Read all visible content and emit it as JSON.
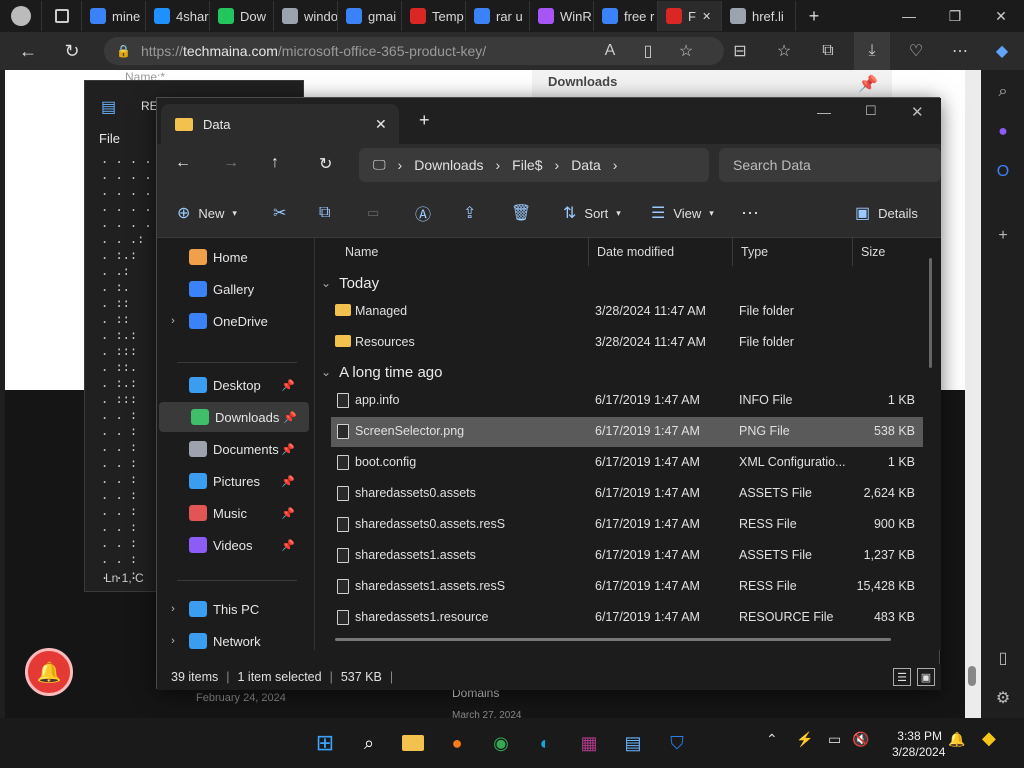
{
  "browser": {
    "tabs": [
      {
        "label": "mine",
        "icon": "search-icon",
        "color": "#3b82f6"
      },
      {
        "label": "4shar",
        "icon": "4shared-icon",
        "color": "#1e90ff"
      },
      {
        "label": "Dow",
        "icon": "download-site-icon",
        "color": "#22c55e"
      },
      {
        "label": "windo",
        "icon": "puzzle-icon",
        "color": "#9ca3af"
      },
      {
        "label": "gmai",
        "icon": "search-icon",
        "color": "#3b82f6"
      },
      {
        "label": "Temp",
        "icon": "mail-icon",
        "color": "#dc2626"
      },
      {
        "label": "rar u",
        "icon": "search-icon",
        "color": "#3b82f6"
      },
      {
        "label": "WinR",
        "icon": "winrar-icon",
        "color": "#a855f7"
      },
      {
        "label": "free r",
        "icon": "search-icon",
        "color": "#3b82f6"
      },
      {
        "label": "F",
        "icon": "site-icon",
        "color": "#dc2626"
      },
      {
        "label": "href.li",
        "icon": "page-icon",
        "color": "#9ca3af"
      }
    ],
    "url": "https://techmaina.com/microsoft-office-365-product-key/",
    "url_host": "techmaina.com",
    "url_scheme": "https://",
    "url_path": "/microsoft-office-365-product-key/"
  },
  "webpage": {
    "partial_text_1": "Name:*",
    "partial_text_2": "Domains",
    "partial_text_3": "February 24, 2024",
    "partial_text_4": "March 27, 2024",
    "partial_text_5": "Downloads"
  },
  "notepad": {
    "menu_file": "File",
    "title_partial": "REA",
    "status_partial": "Ln 1, C"
  },
  "explorer": {
    "tab_title": "Data",
    "breadcrumb": [
      "Downloads",
      "File$",
      "Data"
    ],
    "search_placeholder": "Search Data",
    "commands": {
      "new": "New",
      "sort": "Sort",
      "view": "View",
      "details": "Details"
    },
    "sidebar": [
      {
        "label": "Home",
        "icon": "home-icon",
        "color": "#f0a04b"
      },
      {
        "label": "Gallery",
        "icon": "gallery-icon",
        "color": "#3b82f6"
      },
      {
        "label": "OneDrive",
        "icon": "cloud-icon",
        "color": "#3b82f6"
      },
      {
        "label": "Desktop",
        "icon": "desktop-icon",
        "color": "#3b9df0"
      },
      {
        "label": "Downloads",
        "icon": "download-icon",
        "color": "#3fbf6a"
      },
      {
        "label": "Documents",
        "icon": "documents-icon",
        "color": "#9ca3af"
      },
      {
        "label": "Pictures",
        "icon": "pictures-icon",
        "color": "#3b9df0"
      },
      {
        "label": "Music",
        "icon": "music-icon",
        "color": "#e25555"
      },
      {
        "label": "Videos",
        "icon": "video-icon",
        "color": "#8b5cf6"
      },
      {
        "label": "This PC",
        "icon": "pc-icon",
        "color": "#3b9df0"
      },
      {
        "label": "Network",
        "icon": "network-icon",
        "color": "#3b9df0"
      }
    ],
    "columns": [
      "Name",
      "Date modified",
      "Type",
      "Size"
    ],
    "groups": [
      "Today",
      "A long time ago"
    ],
    "files_today": [
      {
        "name": "Managed",
        "date": "3/28/2024 11:47 AM",
        "type": "File folder",
        "size": ""
      },
      {
        "name": "Resources",
        "date": "3/28/2024 11:47 AM",
        "type": "File folder",
        "size": ""
      }
    ],
    "files_old": [
      {
        "name": "app.info",
        "date": "6/17/2019 1:47 AM",
        "type": "INFO File",
        "size": "1 KB"
      },
      {
        "name": "ScreenSelector.png",
        "date": "6/17/2019 1:47 AM",
        "type": "PNG File",
        "size": "538 KB"
      },
      {
        "name": "boot.config",
        "date": "6/17/2019 1:47 AM",
        "type": "XML Configuratio...",
        "size": "1 KB"
      },
      {
        "name": "sharedassets0.assets",
        "date": "6/17/2019 1:47 AM",
        "type": "ASSETS File",
        "size": "2,624 KB"
      },
      {
        "name": "sharedassets0.assets.resS",
        "date": "6/17/2019 1:47 AM",
        "type": "RESS File",
        "size": "900 KB"
      },
      {
        "name": "sharedassets1.assets",
        "date": "6/17/2019 1:47 AM",
        "type": "ASSETS File",
        "size": "1,237 KB"
      },
      {
        "name": "sharedassets1.assets.resS",
        "date": "6/17/2019 1:47 AM",
        "type": "RESS File",
        "size": "15,428 KB"
      },
      {
        "name": "sharedassets1.resource",
        "date": "6/17/2019 1:47 AM",
        "type": "RESOURCE File",
        "size": "483 KB"
      }
    ],
    "status": {
      "items": "39 items",
      "selected": "1 item selected",
      "size": "537 KB"
    }
  },
  "taskbar": {
    "time": "3:38 PM",
    "date": "3/28/2024"
  }
}
